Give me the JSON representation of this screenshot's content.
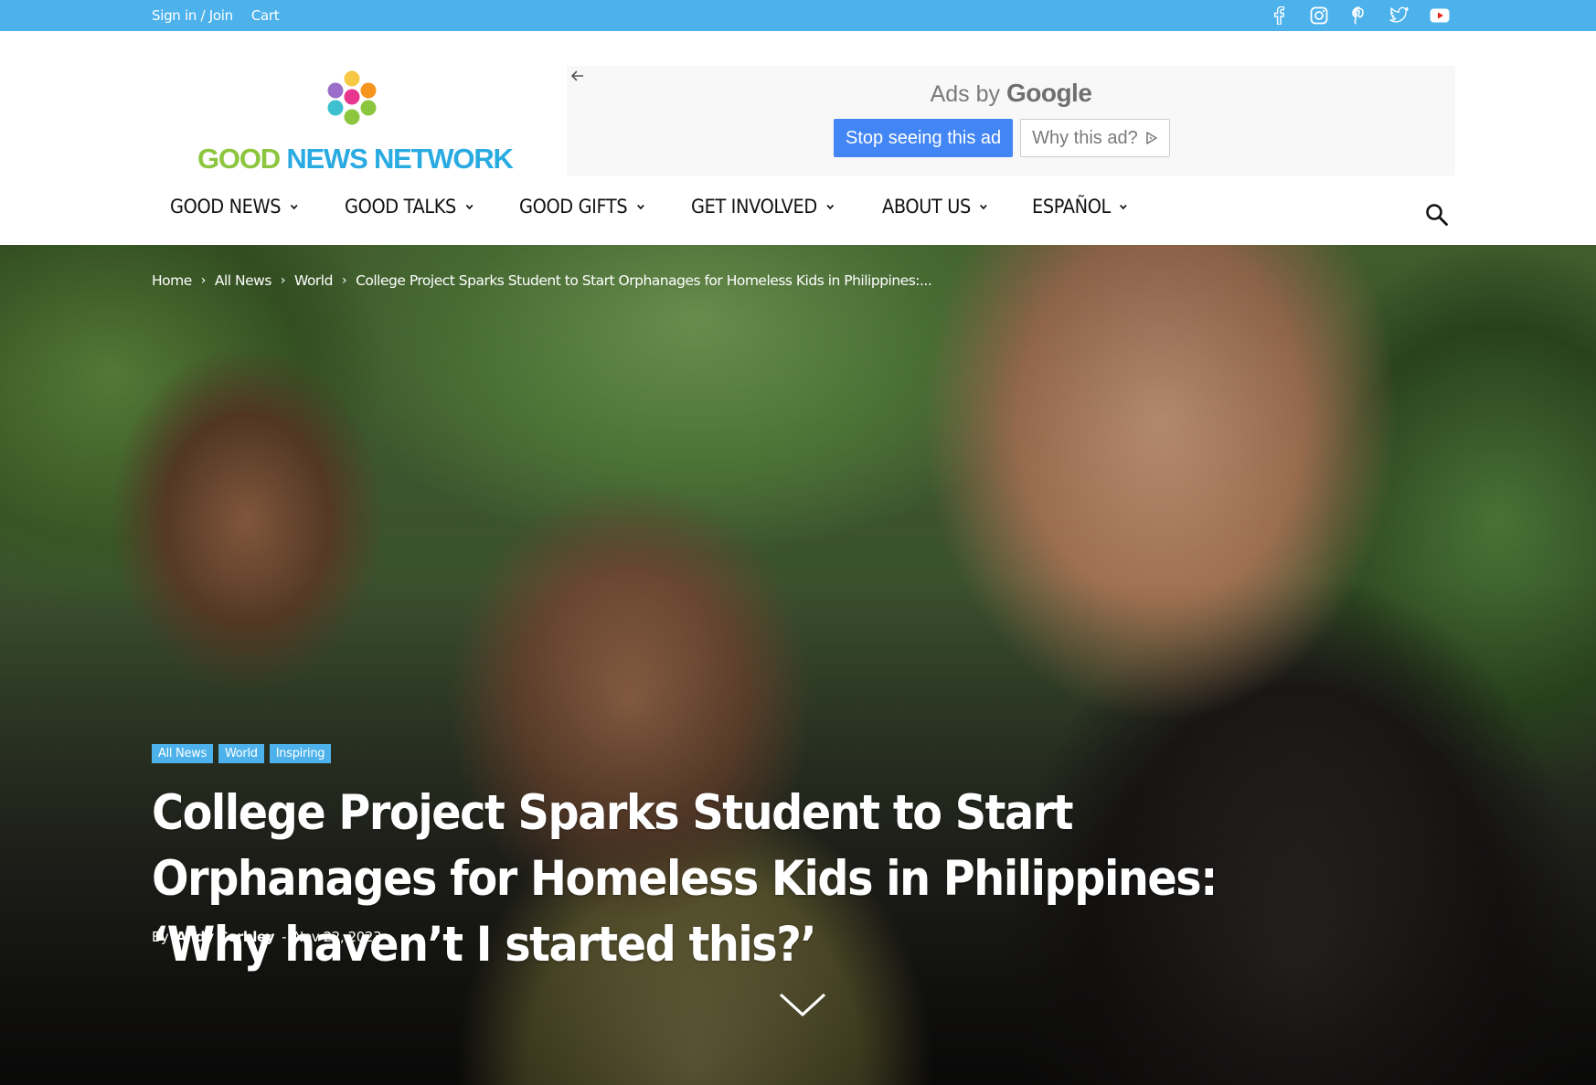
{
  "topbar": {
    "sign_in": "Sign in / Join",
    "cart": "Cart",
    "social": [
      "facebook-icon",
      "instagram-icon",
      "pinterest-icon",
      "twitter-icon",
      "youtube-icon"
    ]
  },
  "logo": {
    "word_good": "GOOD ",
    "word_news": "NEWS NETWORK",
    "dot_colors": [
      "#f7c844",
      "#9b6fc9",
      "#e8368f",
      "#f7941d",
      "#3ec0d0",
      "#8cc63f"
    ]
  },
  "ad": {
    "ads_by": "Ads by ",
    "google": "Google",
    "stop": "Stop seeing this ad",
    "why": "Why this ad?"
  },
  "nav": {
    "items": [
      "GOOD NEWS",
      "GOOD TALKS",
      "GOOD GIFTS",
      "GET INVOLVED",
      "ABOUT US",
      "ESPAÑOL"
    ]
  },
  "breadcrumb": [
    "Home",
    "All News",
    "World",
    "College Project Sparks Student to Start Orphanages for Homeless Kids in Philippines:..."
  ],
  "tags": [
    "All News",
    "World",
    "Inspiring"
  ],
  "article": {
    "title": "College Project Sparks Student to Start Orphanages for Homeless Kids in Philippines: ‘Why haven’t I started this?’",
    "by": "By",
    "author": "Andy Corbley",
    "dash": "-",
    "date": "Nov 22, 2023"
  },
  "colors": {
    "accent": "#4db2ec",
    "google_blue": "#4285f4"
  }
}
